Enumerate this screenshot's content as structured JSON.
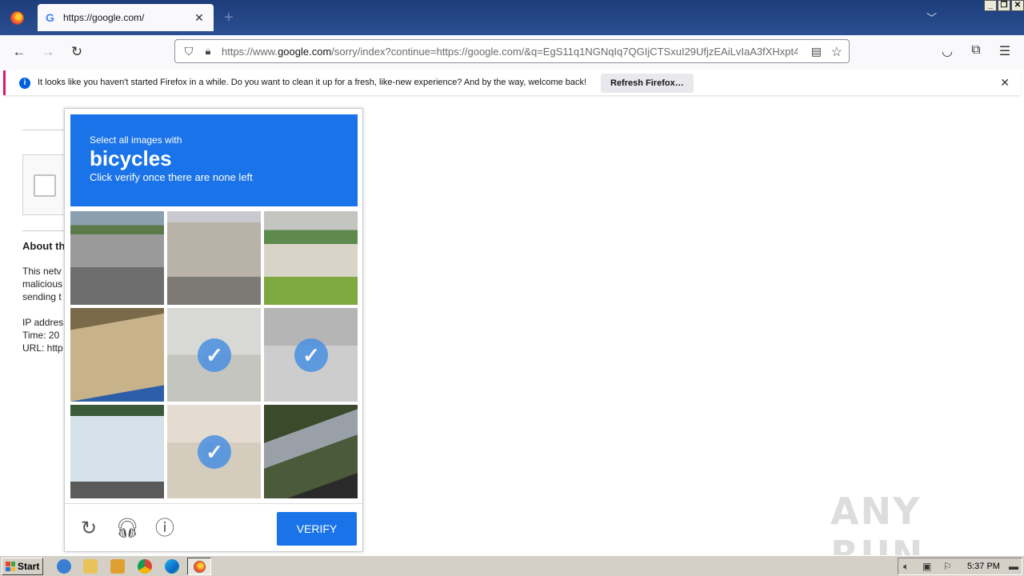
{
  "browser": {
    "tab": {
      "title": "https://google.com/",
      "favicon": "google-g-icon"
    },
    "url": {
      "prefix": "https://www.",
      "domain": "google.com",
      "rest": "/sorry/index?continue=https://google.com/&q=EgS11q1NGNqIq7QGIjCTSxuI29UfjzEAiLvIaA3fXHxpt4U"
    },
    "controls": {
      "minimize": "_",
      "restore": "❐",
      "close": "✕"
    }
  },
  "notification": {
    "text": "It looks like you haven't started Firefox in a while. Do you want to clean it up for a fresh, like-new experience? And by the way, welcome back!",
    "button": "Refresh Firefox…"
  },
  "page": {
    "about_title": "About th",
    "lines": [
      "This netv",
      "malicious",
      "sending t",
      "IP addres",
      "Time: 20",
      "URL: http"
    ]
  },
  "captcha": {
    "instruction_line1": "Select all images with",
    "keyword": "bicycles",
    "instruction_line3": "Click verify once there are none left",
    "tiles": [
      {
        "subject": "parked cars lot",
        "selected": false
      },
      {
        "subject": "building street",
        "selected": false
      },
      {
        "subject": "house with car",
        "selected": false
      },
      {
        "subject": "sandy ground",
        "selected": false
      },
      {
        "subject": "bicycle",
        "selected": true
      },
      {
        "subject": "bicycle wheel",
        "selected": true
      },
      {
        "subject": "minibus",
        "selected": false
      },
      {
        "subject": "person riding bicycle",
        "selected": true
      },
      {
        "subject": "guardrail",
        "selected": false
      }
    ],
    "check_glyph": "✓",
    "verify_label": "VERIFY"
  },
  "watermark": "ANY RUN",
  "taskbar": {
    "start_label": "Start",
    "clock": "5:37 PM"
  }
}
